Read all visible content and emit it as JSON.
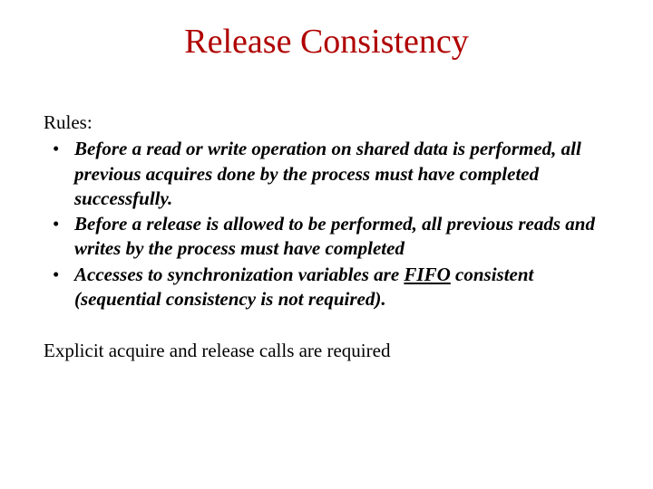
{
  "title": "Release Consistency",
  "rulesLabel": "Rules:",
  "bullets": [
    "Before a read or write operation on shared data is performed, all previous acquires done by the process must have completed successfully.",
    "Before a release is allowed to be performed, all previous reads and writes by the process must have completed"
  ],
  "bullet3_pre": "Accesses to synchronization variables are ",
  "bullet3_fifo": "FIFO",
  "bullet3_post": " consistent (sequential consistency is not required).",
  "footer": "Explicit acquire and release calls are required"
}
